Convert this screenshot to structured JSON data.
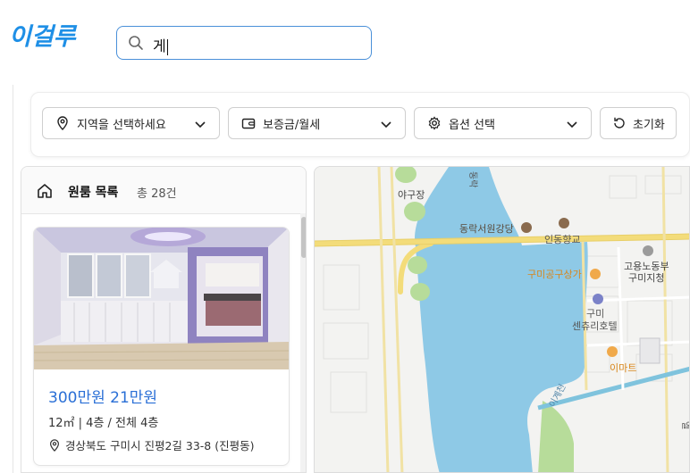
{
  "header": {
    "logo_text": "이걸루",
    "search": {
      "value": "게"
    }
  },
  "filters": {
    "region": "지역을 선택하세요",
    "deposit": "보증금/월세",
    "options": "옵션 선택",
    "reset": "초기화"
  },
  "list": {
    "title": "원룸 목록",
    "count": "총 28건",
    "items": [
      {
        "price": "300만원  21만원",
        "meta": "12㎡  |  4층 / 전체 4층",
        "address": "경상북도 구미시 진평2길 33-8 (진평동)"
      }
    ]
  },
  "map": {
    "labels": {
      "l1": "야구장",
      "l2": "동락서원강당",
      "l3": "인동향교",
      "l4": "구미공구상가",
      "l5": "고용노동부",
      "l6": "구미지청",
      "l7": "구미",
      "l8": "센츄리호텔",
      "l9": "이마트",
      "l10": "이계천",
      "l11": "동락",
      "l12": "엘"
    }
  },
  "colors": {
    "accent": "#2a6fd6",
    "logo": "#1e8fe6",
    "water": "#8ec9e6",
    "road": "#f3dc7a",
    "park": "#b7dc9a"
  }
}
